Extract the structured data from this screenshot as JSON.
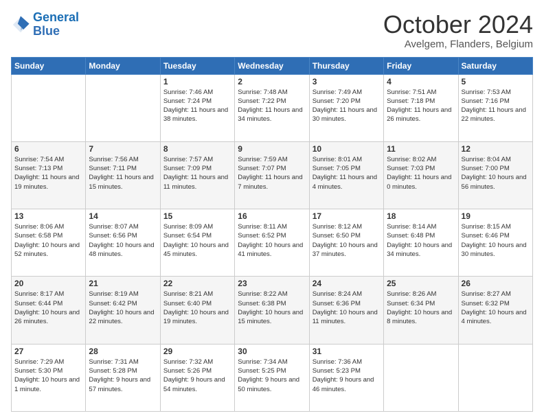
{
  "header": {
    "logo_general": "General",
    "logo_blue": "Blue",
    "title": "October 2024",
    "subtitle": "Avelgem, Flanders, Belgium"
  },
  "days_of_week": [
    "Sunday",
    "Monday",
    "Tuesday",
    "Wednesday",
    "Thursday",
    "Friday",
    "Saturday"
  ],
  "weeks": [
    [
      {
        "day": "",
        "info": ""
      },
      {
        "day": "",
        "info": ""
      },
      {
        "day": "1",
        "info": "Sunrise: 7:46 AM\nSunset: 7:24 PM\nDaylight: 11 hours and 38 minutes."
      },
      {
        "day": "2",
        "info": "Sunrise: 7:48 AM\nSunset: 7:22 PM\nDaylight: 11 hours and 34 minutes."
      },
      {
        "day": "3",
        "info": "Sunrise: 7:49 AM\nSunset: 7:20 PM\nDaylight: 11 hours and 30 minutes."
      },
      {
        "day": "4",
        "info": "Sunrise: 7:51 AM\nSunset: 7:18 PM\nDaylight: 11 hours and 26 minutes."
      },
      {
        "day": "5",
        "info": "Sunrise: 7:53 AM\nSunset: 7:16 PM\nDaylight: 11 hours and 22 minutes."
      }
    ],
    [
      {
        "day": "6",
        "info": "Sunrise: 7:54 AM\nSunset: 7:13 PM\nDaylight: 11 hours and 19 minutes."
      },
      {
        "day": "7",
        "info": "Sunrise: 7:56 AM\nSunset: 7:11 PM\nDaylight: 11 hours and 15 minutes."
      },
      {
        "day": "8",
        "info": "Sunrise: 7:57 AM\nSunset: 7:09 PM\nDaylight: 11 hours and 11 minutes."
      },
      {
        "day": "9",
        "info": "Sunrise: 7:59 AM\nSunset: 7:07 PM\nDaylight: 11 hours and 7 minutes."
      },
      {
        "day": "10",
        "info": "Sunrise: 8:01 AM\nSunset: 7:05 PM\nDaylight: 11 hours and 4 minutes."
      },
      {
        "day": "11",
        "info": "Sunrise: 8:02 AM\nSunset: 7:03 PM\nDaylight: 11 hours and 0 minutes."
      },
      {
        "day": "12",
        "info": "Sunrise: 8:04 AM\nSunset: 7:00 PM\nDaylight: 10 hours and 56 minutes."
      }
    ],
    [
      {
        "day": "13",
        "info": "Sunrise: 8:06 AM\nSunset: 6:58 PM\nDaylight: 10 hours and 52 minutes."
      },
      {
        "day": "14",
        "info": "Sunrise: 8:07 AM\nSunset: 6:56 PM\nDaylight: 10 hours and 48 minutes."
      },
      {
        "day": "15",
        "info": "Sunrise: 8:09 AM\nSunset: 6:54 PM\nDaylight: 10 hours and 45 minutes."
      },
      {
        "day": "16",
        "info": "Sunrise: 8:11 AM\nSunset: 6:52 PM\nDaylight: 10 hours and 41 minutes."
      },
      {
        "day": "17",
        "info": "Sunrise: 8:12 AM\nSunset: 6:50 PM\nDaylight: 10 hours and 37 minutes."
      },
      {
        "day": "18",
        "info": "Sunrise: 8:14 AM\nSunset: 6:48 PM\nDaylight: 10 hours and 34 minutes."
      },
      {
        "day": "19",
        "info": "Sunrise: 8:15 AM\nSunset: 6:46 PM\nDaylight: 10 hours and 30 minutes."
      }
    ],
    [
      {
        "day": "20",
        "info": "Sunrise: 8:17 AM\nSunset: 6:44 PM\nDaylight: 10 hours and 26 minutes."
      },
      {
        "day": "21",
        "info": "Sunrise: 8:19 AM\nSunset: 6:42 PM\nDaylight: 10 hours and 22 minutes."
      },
      {
        "day": "22",
        "info": "Sunrise: 8:21 AM\nSunset: 6:40 PM\nDaylight: 10 hours and 19 minutes."
      },
      {
        "day": "23",
        "info": "Sunrise: 8:22 AM\nSunset: 6:38 PM\nDaylight: 10 hours and 15 minutes."
      },
      {
        "day": "24",
        "info": "Sunrise: 8:24 AM\nSunset: 6:36 PM\nDaylight: 10 hours and 11 minutes."
      },
      {
        "day": "25",
        "info": "Sunrise: 8:26 AM\nSunset: 6:34 PM\nDaylight: 10 hours and 8 minutes."
      },
      {
        "day": "26",
        "info": "Sunrise: 8:27 AM\nSunset: 6:32 PM\nDaylight: 10 hours and 4 minutes."
      }
    ],
    [
      {
        "day": "27",
        "info": "Sunrise: 7:29 AM\nSunset: 5:30 PM\nDaylight: 10 hours and 1 minute."
      },
      {
        "day": "28",
        "info": "Sunrise: 7:31 AM\nSunset: 5:28 PM\nDaylight: 9 hours and 57 minutes."
      },
      {
        "day": "29",
        "info": "Sunrise: 7:32 AM\nSunset: 5:26 PM\nDaylight: 9 hours and 54 minutes."
      },
      {
        "day": "30",
        "info": "Sunrise: 7:34 AM\nSunset: 5:25 PM\nDaylight: 9 hours and 50 minutes."
      },
      {
        "day": "31",
        "info": "Sunrise: 7:36 AM\nSunset: 5:23 PM\nDaylight: 9 hours and 46 minutes."
      },
      {
        "day": "",
        "info": ""
      },
      {
        "day": "",
        "info": ""
      }
    ]
  ]
}
